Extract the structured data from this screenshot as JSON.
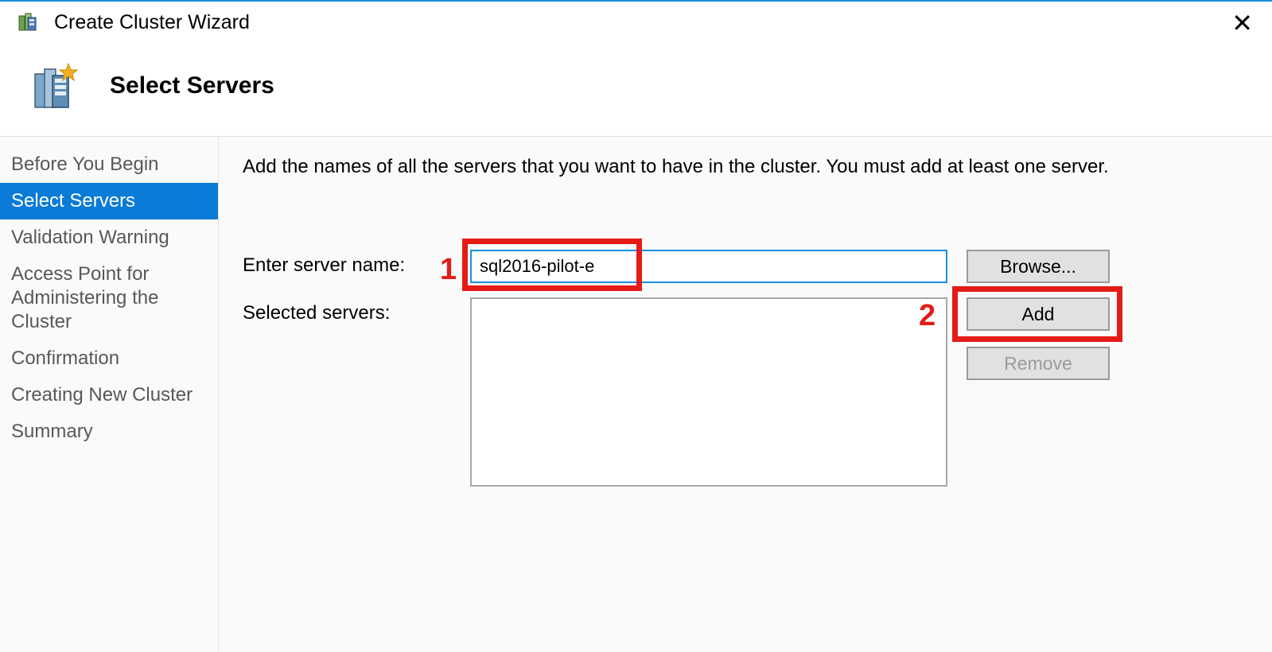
{
  "titlebar": {
    "title": "Create Cluster Wizard"
  },
  "header": {
    "page_title": "Select Servers"
  },
  "sidebar": {
    "items": [
      {
        "label": "Before You Begin",
        "active": false
      },
      {
        "label": "Select Servers",
        "active": true
      },
      {
        "label": "Validation Warning",
        "active": false
      },
      {
        "label": "Access Point for Administering the Cluster",
        "active": false
      },
      {
        "label": "Confirmation",
        "active": false
      },
      {
        "label": "Creating New Cluster",
        "active": false
      },
      {
        "label": "Summary",
        "active": false
      }
    ]
  },
  "main": {
    "instruction": "Add the names of all the servers that you want to have in the cluster. You must add at least one server.",
    "enter_server_label": "Enter server name:",
    "server_name_value": "sql2016-pilot-e",
    "selected_servers_label": "Selected servers:",
    "buttons": {
      "browse": "Browse...",
      "add": "Add",
      "remove": "Remove"
    }
  },
  "annotations": {
    "one": "1",
    "two": "2"
  }
}
